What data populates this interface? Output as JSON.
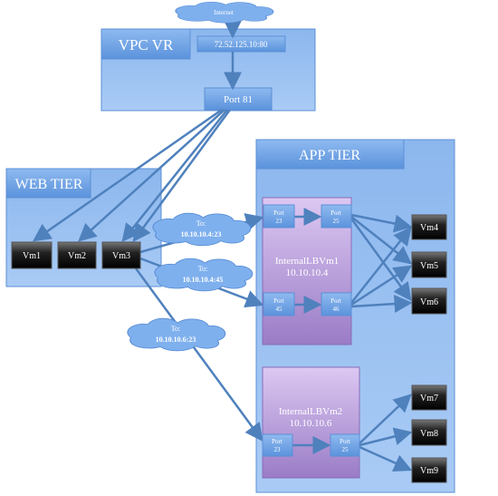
{
  "internet": "Internet",
  "vpc_vr": {
    "title": "VPC VR",
    "public_ip": "72.52.125.10:80",
    "port": "Port 81"
  },
  "web_tier": {
    "title": "WEB TIER",
    "vms": [
      "Vm1",
      "Vm2",
      "Vm3"
    ]
  },
  "app_tier": {
    "title": "APP TIER",
    "lb1": {
      "name": "InternalLBVm1",
      "ip": "10.10.10.4",
      "ports": [
        [
          "Port",
          "23"
        ],
        [
          "Port",
          "25"
        ],
        [
          "Port",
          "45"
        ],
        [
          "Port",
          "46"
        ]
      ]
    },
    "lb2": {
      "name": "InternalLBVm2",
      "ip": "10.10.10.6",
      "ports": [
        [
          "Port",
          "23"
        ],
        [
          "Port",
          "25"
        ]
      ]
    },
    "vms": [
      "Vm4",
      "Vm5",
      "Vm6",
      "Vm7",
      "Vm8",
      "Vm9"
    ]
  },
  "clouds": [
    {
      "to": "To:",
      "target": "10.10.10.4:23"
    },
    {
      "to": "To:",
      "target": "10.10.10.4:45"
    },
    {
      "to": "To:",
      "target": "10.10.10.6:23"
    }
  ],
  "colors": {
    "box": "#6fa3e6",
    "box_light": "#a6c8f4",
    "line": "#4f81bd",
    "lb": "#b49ad6",
    "vm": "#222222"
  }
}
